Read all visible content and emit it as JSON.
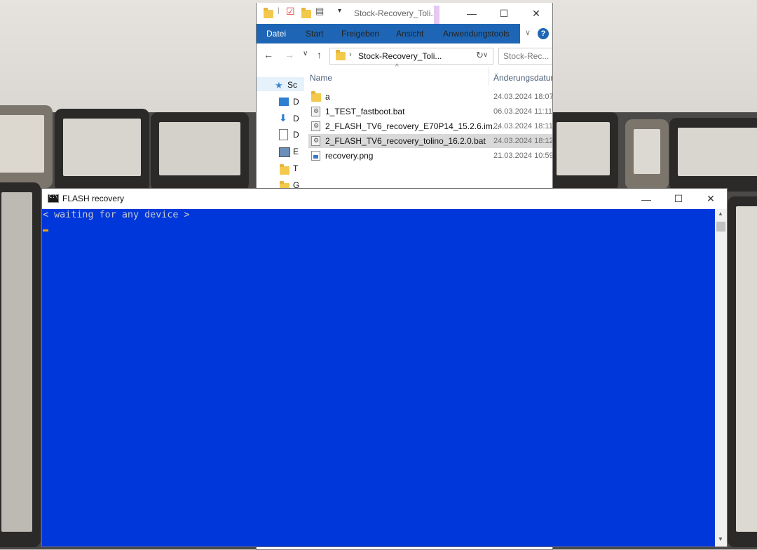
{
  "explorer": {
    "title": "Stock-Recovery_Toli...",
    "ribbon_tabs": [
      "Datei",
      "Start",
      "Freigeben",
      "Ansicht",
      "Anwendungstools"
    ],
    "help_label": "?",
    "address_path": "Stock-Recovery_Toli...",
    "search_placeholder": "Stock-Rec...",
    "nav_items": [
      "Sc",
      "D",
      "D",
      "D",
      "E",
      "T",
      "G"
    ],
    "columns": {
      "name": "Name",
      "date": "Änderungsdatum"
    },
    "files": [
      {
        "name": "a",
        "date": "24.03.2024 18:07",
        "icon": "folder-icon"
      },
      {
        "name": "1_TEST_fastboot.bat",
        "date": "06.03.2024 11:11",
        "icon": "batch-file-icon"
      },
      {
        "name": "2_FLASH_TV6_recovery_E70P14_15.2.6.im...",
        "date": "24.03.2024 18:11",
        "icon": "batch-file-icon"
      },
      {
        "name": "2_FLASH_TV6_recovery_tolino_16.2.0.bat",
        "date": "24.03.2024 18:12",
        "icon": "batch-file-icon",
        "selected": true
      },
      {
        "name": "recovery.png",
        "date": "21.03.2024 10:59",
        "icon": "image-file-icon"
      }
    ]
  },
  "console": {
    "title": "FLASH recovery",
    "output": "< waiting for any device >",
    "background_color": "#0037DA",
    "text_color": "#CCCCCC"
  },
  "window_controls": {
    "minimize": "—",
    "maximize": "☐",
    "close": "✕"
  }
}
